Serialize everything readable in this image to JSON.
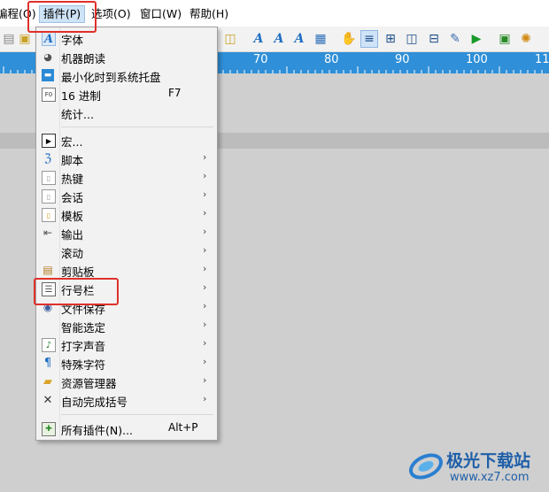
{
  "menubar": {
    "items": [
      {
        "label": "编程(O)"
      },
      {
        "label": "插件(P)"
      },
      {
        "label": "选项(O)"
      },
      {
        "label": "窗口(W)"
      },
      {
        "label": "帮助(H)"
      }
    ]
  },
  "ruler": {
    "labels": [
      "70",
      "80",
      "90",
      "100",
      "11"
    ]
  },
  "plugin_menu": {
    "items": [
      {
        "label": "字体",
        "icon": "font-a-icon"
      },
      {
        "label": "机器朗读",
        "icon": "speaker-icon"
      },
      {
        "label": "最小化时到系统托盘",
        "icon": "tray-icon"
      },
      {
        "label": "16 进制",
        "shortcut": "F7",
        "icon": "hex-icon"
      },
      {
        "label": "统计...",
        "icon": ""
      },
      {
        "label": "宏...",
        "icon": "macro-icon"
      },
      {
        "label": "脚本",
        "icon": "script-icon",
        "submenu": true
      },
      {
        "label": "热键",
        "icon": "hotkey-icon",
        "submenu": true
      },
      {
        "label": "会话",
        "icon": "session-icon",
        "submenu": true
      },
      {
        "label": "模板",
        "icon": "template-icon",
        "submenu": true
      },
      {
        "label": "输出",
        "icon": "output-icon",
        "submenu": true
      },
      {
        "label": "滚动",
        "icon": "",
        "submenu": true
      },
      {
        "label": "剪贴板",
        "icon": "clipboard-icon",
        "submenu": true
      },
      {
        "label": "行号栏",
        "icon": "line-number-icon",
        "submenu": true
      },
      {
        "label": "文件保存",
        "icon": "file-save-icon",
        "submenu": true
      },
      {
        "label": "智能选定",
        "icon": "",
        "submenu": true
      },
      {
        "label": "打字声音",
        "icon": "music-note-icon",
        "submenu": true
      },
      {
        "label": "特殊字符",
        "icon": "pilcrow-icon",
        "submenu": true
      },
      {
        "label": "资源管理器",
        "icon": "folder-icon",
        "submenu": true
      },
      {
        "label": "自动完成括号",
        "icon": "brackets-icon",
        "submenu": true
      },
      {
        "label": "所有插件(N)...",
        "shortcut": "Alt+P",
        "icon": "plugin-icon"
      }
    ]
  },
  "watermark": {
    "title": "极光下载站",
    "url": "www.xz7.com"
  },
  "colors": {
    "ruler": "#2f8fd8",
    "highlight": "#e0302a",
    "menu_active": "#cfe3f7"
  }
}
